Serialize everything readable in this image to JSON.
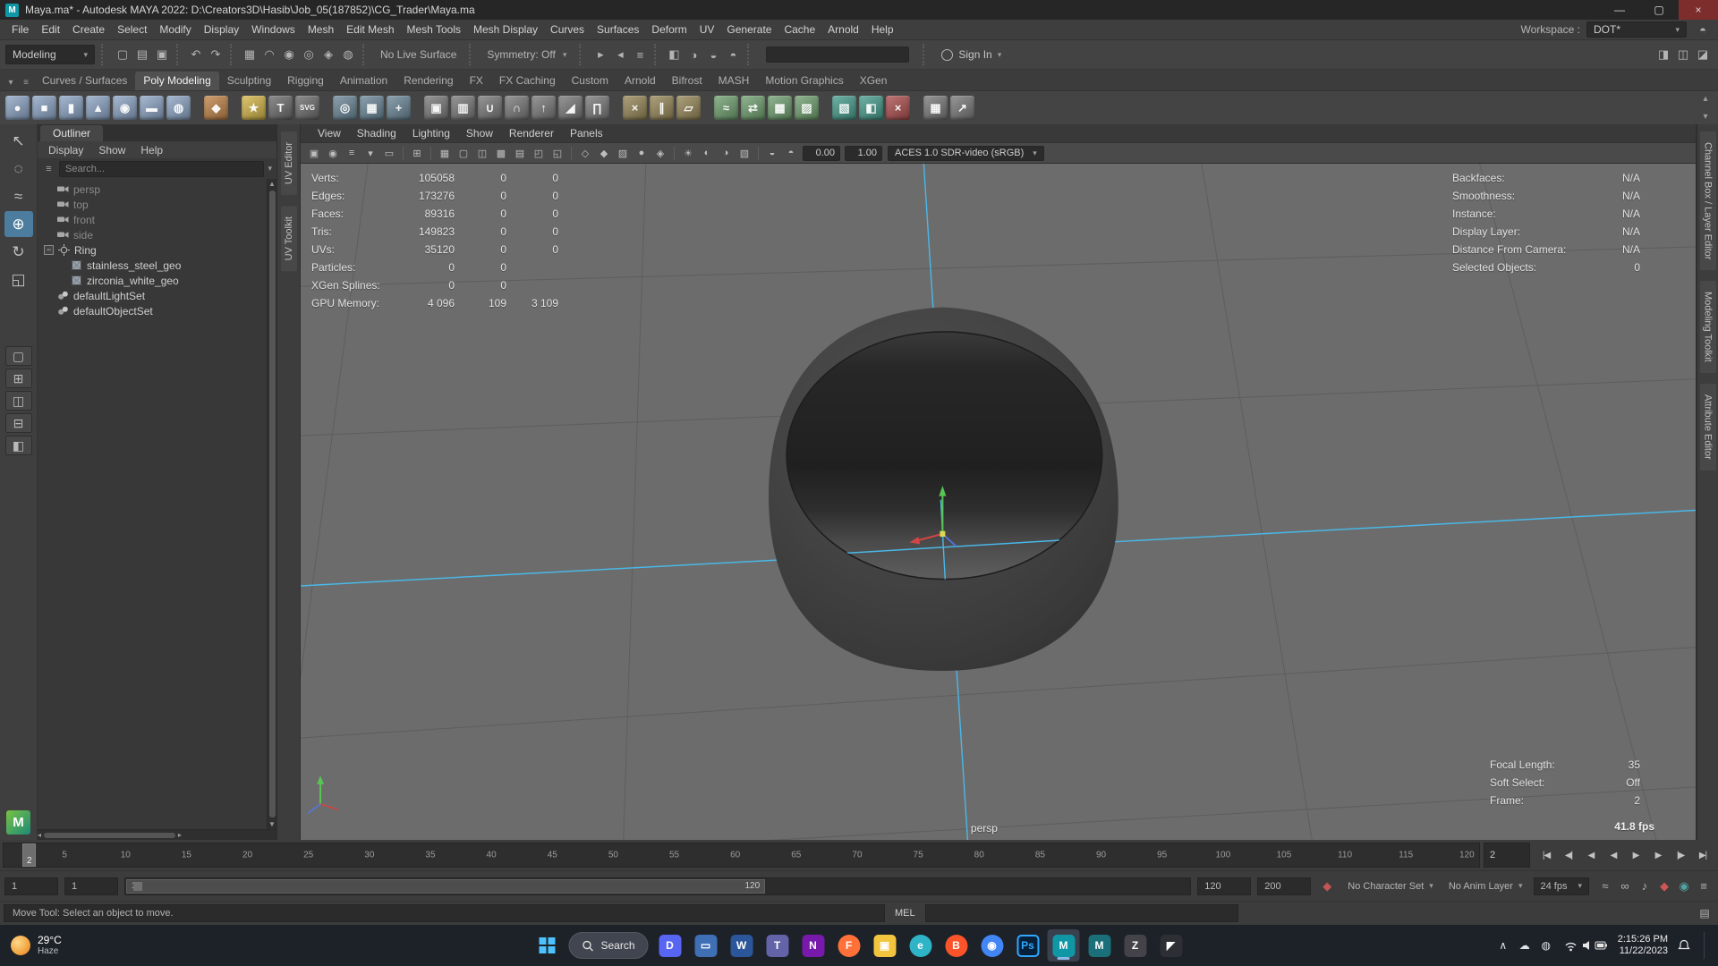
{
  "window": {
    "app_badge": "M",
    "title": "Maya.ma* - Autodesk MAYA 2022: D:\\Creators3D\\Hasib\\Job_05(187852)\\CG_Trader\\Maya.ma",
    "minimize_glyph": "—",
    "maximize_glyph": "▢",
    "close_glyph": "×"
  },
  "menu_bar": {
    "menus": [
      "File",
      "Edit",
      "Create",
      "Select",
      "Modify",
      "Display",
      "Windows",
      "Mesh",
      "Edit Mesh",
      "Mesh Tools",
      "Mesh Display",
      "Curves",
      "Surfaces",
      "Deform",
      "UV",
      "Generate",
      "Cache",
      "Arnold",
      "Help"
    ],
    "workspace_label": "Workspace :",
    "workspace_value": "DOT*"
  },
  "status_line": {
    "mode": "Modeling",
    "left_icons": [
      {
        "name": "file-new-icon",
        "glyph": "▢"
      },
      {
        "name": "file-open-icon",
        "glyph": "▤"
      },
      {
        "name": "file-save-icon",
        "glyph": "▣"
      },
      {
        "name": "sep"
      },
      {
        "name": "undo-icon",
        "glyph": "↶"
      },
      {
        "name": "redo-icon",
        "glyph": "↷"
      },
      {
        "name": "sep"
      },
      {
        "name": "snap-grid-icon",
        "glyph": "▦"
      },
      {
        "name": "snap-curve-icon",
        "glyph": "◠"
      },
      {
        "name": "snap-point-icon",
        "glyph": "◉"
      },
      {
        "name": "snap-projected-center-icon",
        "glyph": "◎"
      },
      {
        "name": "snap-view-plane-icon",
        "glyph": "◈"
      },
      {
        "name": "make-live-icon",
        "glyph": "◍"
      },
      {
        "name": "sep"
      }
    ],
    "live_surface": "No Live Surface",
    "symmetry": "Symmetry: Off",
    "right_icons": [
      {
        "name": "input-operations-icon",
        "glyph": "▸"
      },
      {
        "name": "output-operations-icon",
        "glyph": "◂"
      },
      {
        "name": "construction-history-icon",
        "glyph": "≡"
      },
      {
        "name": "sep"
      },
      {
        "name": "open-render-view-icon",
        "glyph": "◧"
      },
      {
        "name": "render-current-frame-icon",
        "glyph": "◑"
      },
      {
        "name": "ipr-render-icon",
        "glyph": "◒"
      },
      {
        "name": "render-settings-icon",
        "glyph": "◓"
      },
      {
        "name": "sep"
      }
    ],
    "sign_in": "Sign In",
    "far_icons": [
      {
        "name": "modeling-toolkit-toggle-icon",
        "glyph": "◨"
      },
      {
        "name": "channel-box-toggle-icon",
        "glyph": "◫"
      },
      {
        "name": "attribute-editor-toggle-icon",
        "glyph": "◪"
      }
    ]
  },
  "shelf": {
    "tabs": [
      "Curves / Surfaces",
      "Poly Modeling",
      "Sculpting",
      "Rigging",
      "Animation",
      "Rendering",
      "FX",
      "FX Caching",
      "Custom",
      "Arnold",
      "Bifrost",
      "MASH",
      "Motion Graphics",
      "XGen"
    ],
    "active_tab": "Poly Modeling",
    "icons": [
      {
        "name": "poly-sphere",
        "glyph": "●",
        "color": "#8fa8c8"
      },
      {
        "name": "poly-cube",
        "glyph": "■",
        "color": "#8fa8c8"
      },
      {
        "name": "poly-cylinder",
        "glyph": "▮",
        "color": "#8fa8c8"
      },
      {
        "name": "poly-cone",
        "glyph": "▲",
        "color": "#8fa8c8"
      },
      {
        "name": "poly-torus",
        "glyph": "◉",
        "color": "#8fa8c8"
      },
      {
        "name": "poly-plane",
        "glyph": "▬",
        "color": "#8fa8c8"
      },
      {
        "name": "poly-disc",
        "glyph": "◍",
        "color": "#8fa8c8"
      },
      {
        "name": "sep"
      },
      {
        "name": "super-shape",
        "glyph": "◆",
        "color": "#c4874a"
      },
      {
        "name": "sep"
      },
      {
        "name": "star-poly",
        "glyph": "★",
        "color": "#d8b94a"
      },
      {
        "name": "type-tool",
        "glyph": "T",
        "color": "#6f6f6f"
      },
      {
        "name": "svg-tool",
        "glyph": "SVG",
        "color": "#6f6f6f"
      },
      {
        "name": "sep"
      },
      {
        "name": "make-live",
        "glyph": "◎",
        "color": "#6d8a9a"
      },
      {
        "name": "construction-plane",
        "glyph": "▦",
        "color": "#6d8a9a"
      },
      {
        "name": "free-point",
        "glyph": "+",
        "color": "#6d8a9a"
      },
      {
        "name": "sep"
      },
      {
        "name": "combine",
        "glyph": "▣",
        "color": "#7c7c7c"
      },
      {
        "name": "separate",
        "glyph": "▥",
        "color": "#7c7c7c"
      },
      {
        "name": "boolean-union",
        "glyph": "∪",
        "color": "#7c7c7c"
      },
      {
        "name": "boolean-difference",
        "glyph": "∩",
        "color": "#7c7c7c"
      },
      {
        "name": "extrude",
        "glyph": "↑",
        "color": "#7c7c7c"
      },
      {
        "name": "bevel",
        "glyph": "◢",
        "color": "#7c7c7c"
      },
      {
        "name": "bridge",
        "glyph": "∏",
        "color": "#7c7c7c"
      },
      {
        "name": "sep"
      },
      {
        "name": "multi-cut",
        "glyph": "×",
        "color": "#9a8a5a"
      },
      {
        "name": "insert-edge-loop",
        "glyph": "∥",
        "color": "#9a8a5a"
      },
      {
        "name": "quad-draw",
        "glyph": "▱",
        "color": "#9a8a5a"
      },
      {
        "name": "sep"
      },
      {
        "name": "smooth-mesh",
        "glyph": "≈",
        "color": "#72a372"
      },
      {
        "name": "mirror-geometry",
        "glyph": "⇄",
        "color": "#72a372"
      },
      {
        "name": "remesh",
        "glyph": "▩",
        "color": "#72a372"
      },
      {
        "name": "retopologize",
        "glyph": "▨",
        "color": "#72a372"
      },
      {
        "name": "sep"
      },
      {
        "name": "uv-planar",
        "glyph": "▧",
        "color": "#49a08f"
      },
      {
        "name": "uv-auto",
        "glyph": "◧",
        "color": "#49a08f"
      },
      {
        "name": "cut-uv",
        "glyph": "×",
        "color": "#b05050"
      },
      {
        "name": "sep"
      },
      {
        "name": "grid-toggle",
        "glyph": "▦",
        "color": "#7c7c7c"
      },
      {
        "name": "export-selection",
        "glyph": "↗",
        "color": "#7c7c7c"
      }
    ]
  },
  "toolbox": {
    "tools": [
      {
        "name": "select-tool",
        "glyph": "↖"
      },
      {
        "name": "lasso-select-tool",
        "glyph": "◌"
      },
      {
        "name": "paint-select-tool",
        "glyph": "≈"
      },
      {
        "name": "move-tool",
        "glyph": "⊕",
        "active": true
      },
      {
        "name": "rotate-tool",
        "glyph": "↻"
      },
      {
        "name": "scale-tool",
        "glyph": "◱"
      }
    ],
    "layouts": [
      {
        "name": "single-pane-layout",
        "glyph": "▢"
      },
      {
        "name": "four-pane-layout",
        "glyph": "⊞"
      },
      {
        "name": "two-pane-side-layout",
        "glyph": "◫"
      },
      {
        "name": "two-pane-stacked-layout",
        "glyph": "⊟"
      },
      {
        "name": "outliner-persp-layout",
        "glyph": "◧"
      }
    ]
  },
  "outliner": {
    "title": "Outliner",
    "menus": [
      "Display",
      "Show",
      "Help"
    ],
    "search_placeholder": "Search...",
    "items": [
      {
        "label": "persp",
        "icon": "camera",
        "depth": 1,
        "dim": true
      },
      {
        "label": "top",
        "icon": "camera",
        "depth": 1,
        "dim": true
      },
      {
        "label": "front",
        "icon": "camera",
        "depth": 1,
        "dim": true
      },
      {
        "label": "side",
        "icon": "camera",
        "depth": 1,
        "dim": true
      },
      {
        "label": "Ring",
        "icon": "transform",
        "depth": 1,
        "expandable": true
      },
      {
        "label": "stainless_steel_geo",
        "icon": "mesh",
        "depth": 2
      },
      {
        "label": "zirconia_white_geo",
        "icon": "mesh",
        "depth": 2
      },
      {
        "label": "defaultLightSet",
        "icon": "set",
        "depth": 1
      },
      {
        "label": "defaultObjectSet",
        "icon": "set",
        "depth": 1
      }
    ]
  },
  "side_panels": {
    "left_tabs": [
      "UV Editor",
      "UV Toolkit"
    ],
    "right_tabs": [
      "Channel Box / Layer Editor",
      "Modeling Toolkit",
      "Attribute Editor"
    ]
  },
  "panel": {
    "menus": [
      "View",
      "Shading",
      "Lighting",
      "Show",
      "Renderer",
      "Panels"
    ],
    "toolbar_icons": [
      {
        "name": "camera-select-icon",
        "glyph": "▣"
      },
      {
        "name": "camera-lock-icon",
        "glyph": "◉"
      },
      {
        "name": "camera-attributes-icon",
        "glyph": "≡"
      },
      {
        "name": "bookmark-icon",
        "glyph": "▾"
      },
      {
        "name": "image-plane-icon",
        "glyph": "▭"
      },
      {
        "name": "sep"
      },
      {
        "name": "2d-pan-zoom-icon",
        "glyph": "⊞"
      },
      {
        "name": "sep"
      },
      {
        "name": "grid-icon",
        "glyph": "▦"
      },
      {
        "name": "film-gate-icon",
        "glyph": "▢"
      },
      {
        "name": "resolution-gate-icon",
        "glyph": "◫"
      },
      {
        "name": "gate-mask-icon",
        "glyph": "▩"
      },
      {
        "name": "field-chart-icon",
        "glyph": "▤"
      },
      {
        "name": "safe-action-icon",
        "glyph": "◰"
      },
      {
        "name": "safe-title-icon",
        "glyph": "◱"
      },
      {
        "name": "sep"
      },
      {
        "name": "wireframe-icon",
        "glyph": "◇"
      },
      {
        "name": "shaded-icon",
        "glyph": "◆"
      },
      {
        "name": "textured-icon",
        "glyph": "▨"
      },
      {
        "name": "use-default-material-icon",
        "glyph": "●"
      },
      {
        "name": "wireframe-on-shaded-icon",
        "glyph": "◈"
      },
      {
        "name": "sep"
      },
      {
        "name": "lighting-icon",
        "glyph": "☀"
      },
      {
        "name": "shadows-icon",
        "glyph": "◐"
      },
      {
        "name": "ambient-occlusion-icon",
        "glyph": "◑"
      },
      {
        "name": "anti-alias-icon",
        "glyph": "▧"
      },
      {
        "name": "sep"
      },
      {
        "name": "exposure-icon",
        "glyph": "◒"
      },
      {
        "name": "gamma-icon",
        "glyph": "◓"
      }
    ],
    "exposure": "0.00",
    "gamma": "1.00",
    "colorspace": "ACES 1.0 SDR-video (sRGB)"
  },
  "hud": {
    "left": [
      {
        "label": "Verts:",
        "values": [
          "105058",
          "0",
          "0"
        ]
      },
      {
        "label": "Edges:",
        "values": [
          "173276",
          "0",
          "0"
        ]
      },
      {
        "label": "Faces:",
        "values": [
          "89316",
          "0",
          "0"
        ]
      },
      {
        "label": "Tris:",
        "values": [
          "149823",
          "0",
          "0"
        ]
      },
      {
        "label": "UVs:",
        "values": [
          "35120",
          "0",
          "0"
        ]
      },
      {
        "label": "Particles:",
        "values": [
          "0",
          "0",
          ""
        ]
      },
      {
        "label": "XGen Splines:",
        "values": [
          "0",
          "0",
          ""
        ]
      },
      {
        "label": "GPU Memory:",
        "values": [
          "4 096",
          "109",
          "3 109"
        ]
      }
    ],
    "right": [
      {
        "label": "Backfaces:",
        "value": "N/A"
      },
      {
        "label": "Smoothness:",
        "value": "N/A"
      },
      {
        "label": "Instance:",
        "value": "N/A"
      },
      {
        "label": "Display Layer:",
        "value": "N/A"
      },
      {
        "label": "Distance From Camera:",
        "value": "N/A"
      },
      {
        "label": "Selected Objects:",
        "value": "0"
      }
    ],
    "bottom_right": [
      {
        "label": "Focal Length:",
        "value": "35"
      },
      {
        "label": "Soft Select:",
        "value": "Off"
      },
      {
        "label": "Frame:",
        "value": "2"
      }
    ],
    "fps": "41.8 fps",
    "camera_label": "persp"
  },
  "timeline": {
    "ticks": [
      "5",
      "10",
      "15",
      "20",
      "25",
      "30",
      "35",
      "40",
      "45",
      "50",
      "55",
      "60",
      "65",
      "70",
      "75",
      "80",
      "85",
      "90",
      "95",
      "100",
      "105",
      "110",
      "115",
      "120"
    ],
    "current_frame": "2",
    "frame_field": "2",
    "playback": [
      {
        "name": "go-to-start-button",
        "glyph": "|◀"
      },
      {
        "name": "previous-key-button",
        "glyph": "◀|"
      },
      {
        "name": "step-back-button",
        "glyph": "◀"
      },
      {
        "name": "play-backwards-button",
        "glyph": "◀"
      },
      {
        "name": "play-forward-button",
        "glyph": "▶"
      },
      {
        "name": "step-forward-button",
        "glyph": "▶"
      },
      {
        "name": "next-key-button",
        "glyph": "|▶"
      },
      {
        "name": "go-to-end-button",
        "glyph": "▶|"
      }
    ]
  },
  "range_slider": {
    "min_field": "1",
    "start_field": "1",
    "bar_start": "1",
    "bar_end": "120",
    "end_field": "120",
    "max_field": "200",
    "mid_icons": [
      {
        "name": "character-key-icon",
        "glyph": "◆",
        "color": "#c25555"
      }
    ],
    "character_set": "No Character Set",
    "anim_layer": "No Anim Layer",
    "fps": "24 fps",
    "right_icons": [
      {
        "name": "playback-speed-icon",
        "glyph": "≈"
      },
      {
        "name": "loop-icon",
        "glyph": "∞"
      },
      {
        "name": "sound-icon",
        "glyph": "♪"
      },
      {
        "name": "auto-keyframe-icon",
        "glyph": "◆",
        "color": "#cc5555"
      },
      {
        "name": "evaluation-mode-icon",
        "glyph": "◉",
        "color": "#4fa3a0"
      },
      {
        "name": "animation-preferences-icon",
        "glyph": "≡"
      }
    ]
  },
  "command_line": {
    "help_text": "Move Tool: Select an object to move.",
    "mel_label": "MEL",
    "input_value": ""
  },
  "taskbar": {
    "weather": {
      "temp": "29°C",
      "desc": "Haze"
    },
    "search_label": "Search",
    "apps": [
      {
        "name": "discord",
        "glyph": "D",
        "color": "#5865f2"
      },
      {
        "name": "remote-desktop",
        "glyph": "▭",
        "color": "#3f6fb5"
      },
      {
        "name": "word",
        "glyph": "W",
        "color": "#2b579a"
      },
      {
        "name": "teams",
        "glyph": "T",
        "color": "#6264a7"
      },
      {
        "name": "onenote",
        "glyph": "N",
        "color": "#7719aa"
      },
      {
        "name": "firefox",
        "glyph": "F",
        "color": "#ff7139",
        "round": true
      },
      {
        "name": "file-explorer",
        "glyph": "▣",
        "color": "#f3c53f"
      },
      {
        "name": "edge",
        "glyph": "e",
        "color": "#2fb3c7",
        "round": true
      },
      {
        "name": "brave",
        "glyph": "B",
        "color": "#fb542b",
        "round": true
      },
      {
        "name": "chrome",
        "glyph": "◉",
        "color": "#4285f4",
        "round": true
      },
      {
        "name": "photoshop",
        "glyph": "Ps",
        "color": "#06203a"
      },
      {
        "name": "maya",
        "glyph": "M",
        "color": "#0f97a6",
        "active": true
      },
      {
        "name": "mudbox",
        "glyph": "M",
        "color": "#1a6f78"
      },
      {
        "name": "zbrush",
        "glyph": "Z",
        "color": "#44434a"
      },
      {
        "name": "cursor-app",
        "glyph": "◤",
        "color": "#2e2e35"
      }
    ],
    "tray_icons": [
      {
        "name": "hidden-icons-chevron",
        "glyph": "∧"
      },
      {
        "name": "onedrive-icon",
        "glyph": "☁"
      },
      {
        "name": "security-icon",
        "glyph": "◍"
      }
    ],
    "tray_time": "2:15:26 PM",
    "tray_date": "11/22/2023"
  }
}
